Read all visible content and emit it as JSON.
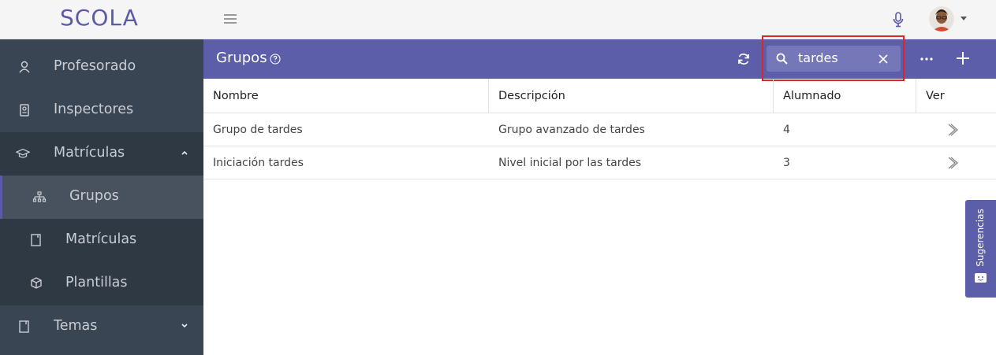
{
  "app": {
    "logo": "SCOLA"
  },
  "sidebar": {
    "items": [
      {
        "label": "Profesorado",
        "icon": "user-icon"
      },
      {
        "label": "Inspectores",
        "icon": "badge-icon"
      },
      {
        "label": "Matrículas",
        "icon": "graduation-cap-icon",
        "expanded": true
      },
      {
        "label": "Grupos",
        "icon": "hierarchy-icon",
        "active": true
      },
      {
        "label": "Matrículas",
        "icon": "notebook-icon"
      },
      {
        "label": "Plantillas",
        "icon": "cube-icon"
      },
      {
        "label": "Temas",
        "icon": "notebook-icon",
        "expanded": false
      }
    ]
  },
  "header": {
    "title": "Grupos",
    "search_value": "tardes",
    "colors": {
      "header_bg": "#5d5ea9",
      "sidebar_bg": "#3a4553",
      "highlight": "#d9262b"
    }
  },
  "table": {
    "columns": [
      "Nombre",
      "Descripción",
      "Alumnado",
      "Ver"
    ],
    "rows": [
      {
        "nombre": "Grupo de tardes",
        "descripcion": "Grupo avanzado de tardes",
        "alumnado": "4"
      },
      {
        "nombre": "Iniciación tardes",
        "descripcion": "Nivel inicial por las tardes",
        "alumnado": "3"
      }
    ]
  },
  "feedback": {
    "label": "Sugerencias"
  }
}
